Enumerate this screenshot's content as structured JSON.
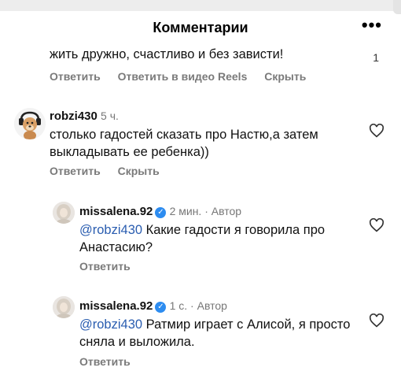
{
  "header": {
    "title": "Комментарии",
    "more_label": "•••"
  },
  "top_comment": {
    "text_tail": "жить дружно, счастливо и без зависти!",
    "like_count": "1",
    "actions": [
      "Ответить",
      "Ответить в видео Reels",
      "Скрыть"
    ]
  },
  "comments": [
    {
      "username": "robzi430",
      "time": "5 ч.",
      "text": "столько гадостей сказать про Настю,а затем выкладывать ее ребенка))",
      "actions": [
        "Ответить",
        "Скрыть"
      ]
    },
    {
      "username": "missalena.92",
      "verified": true,
      "time": "2 мин.",
      "author_label": "Автор",
      "mention": "@robzi430",
      "text": "Какие гадости я говорила про Анастасию?",
      "actions": [
        "Ответить"
      ]
    },
    {
      "username": "missalena.92",
      "verified": true,
      "time": "1 с.",
      "author_label": "Автор",
      "mention": "@robzi430",
      "text": "Ратмир играет с Алисой, я просто сняла и выложила.",
      "actions": [
        "Ответить"
      ]
    }
  ],
  "icons": {
    "like": "heart-outline-icon",
    "verified": "check-badge-icon"
  },
  "colors": {
    "accent_link": "#2a5db0",
    "verified_badge": "#2d8cf0",
    "secondary_text": "#7a7a7a"
  }
}
